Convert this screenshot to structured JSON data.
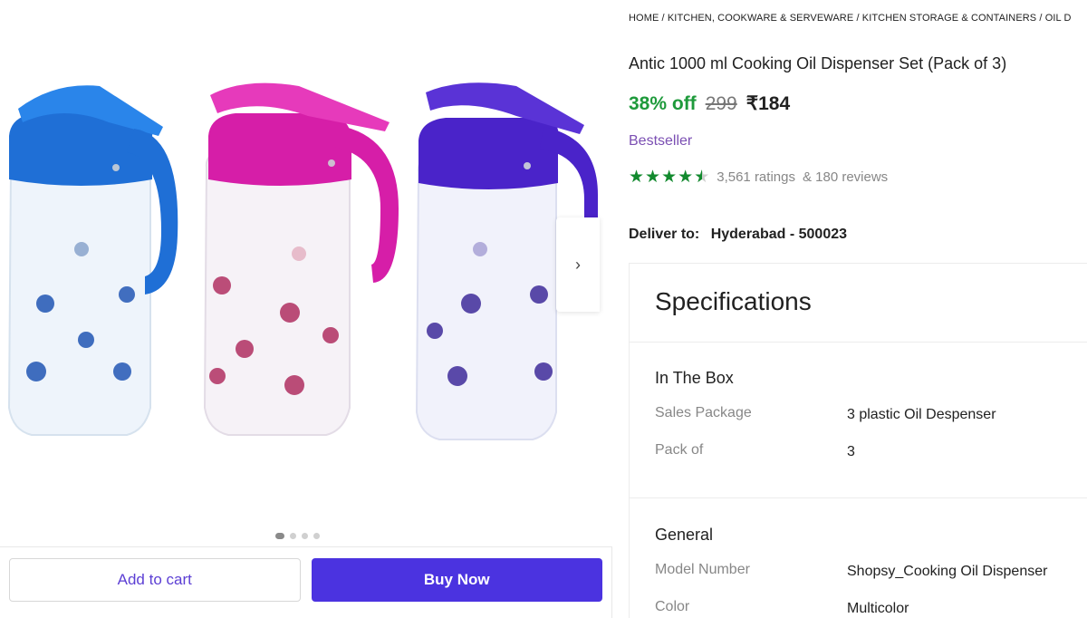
{
  "breadcrumb": {
    "home": "HOME",
    "sep": " / ",
    "level1": "KITCHEN, COOKWARE & SERVEWARE",
    "level2": "KITCHEN STORAGE & CONTAINERS",
    "level3": "OIL D"
  },
  "product": {
    "title": "Antic 1000 ml Cooking Oil Dispenser Set (Pack of 3)",
    "discount": "38% off",
    "mrp": "299",
    "price": "₹184",
    "badge": "Bestseller",
    "rating_value": 4.5,
    "ratings_text": "3,561 ratings",
    "reviews_text": "& 180 reviews",
    "images_total": 4,
    "image_index": 1
  },
  "delivery": {
    "label": "Deliver to:",
    "location": "Hyderabad - 500023"
  },
  "actions": {
    "add_to_cart": "Add to cart",
    "buy_now": "Buy Now"
  },
  "specifications": {
    "title": "Specifications",
    "sections": [
      {
        "heading": "In The Box",
        "rows": [
          {
            "key": "Sales Package",
            "value": "3 plastic Oil Despenser"
          },
          {
            "key": "Pack of",
            "value": "3"
          }
        ]
      },
      {
        "heading": "General",
        "rows": [
          {
            "key": "Model Number",
            "value": "Shopsy_Cooking Oil Dispenser"
          },
          {
            "key": "Color",
            "value": "Multicolor"
          }
        ]
      }
    ]
  },
  "colors": {
    "discount_green": "#1e9a3b",
    "badge_purple": "#7b4fb3",
    "buy_button": "#4b33e0",
    "star_green": "#128a2e",
    "jar_blue": "#1f6fd6",
    "jar_pink": "#d61ea8",
    "jar_purple": "#4a23c9"
  },
  "icons": {
    "next": "chevron-right-icon",
    "star": "star-icon"
  }
}
